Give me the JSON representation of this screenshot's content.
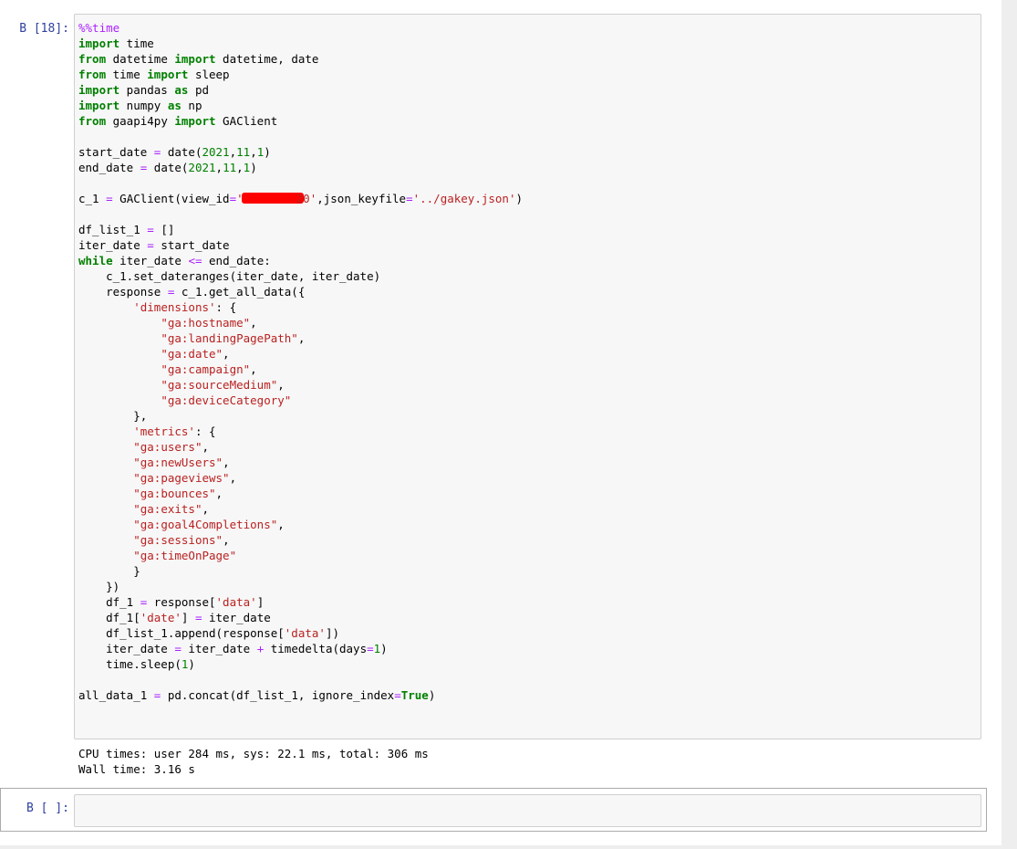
{
  "cells": [
    {
      "prompt": "В [18]:",
      "code": {
        "l1_magic": "%%time",
        "l2_import": "import",
        "l2_rest": " time",
        "l3_from": "from",
        "l3_mid": " datetime ",
        "l3_import": "import",
        "l3_rest": " datetime, date",
        "l4_from": "from",
        "l4_mid": " time ",
        "l4_import": "import",
        "l4_rest": " sleep",
        "l5_import": "import",
        "l5_mid": " pandas ",
        "l5_as": "as",
        "l5_rest": " pd",
        "l6_import": "import",
        "l6_mid": " numpy ",
        "l6_as": "as",
        "l6_rest": " np",
        "l7_from": "from",
        "l7_mid": " gaapi4py ",
        "l7_import": "import",
        "l7_rest": " GAClient",
        "l9_a": "start_date ",
        "l9_eq": "=",
        "l9_b": " date(",
        "l9_n1": "2021",
        "l9_c1": ",",
        "l9_n2": "11",
        "l9_c2": ",",
        "l9_n3": "1",
        "l9_d": ")",
        "l10_a": "end_date ",
        "l10_eq": "=",
        "l10_b": " date(",
        "l10_n1": "2021",
        "l10_c1": ",",
        "l10_n2": "11",
        "l10_c2": ",",
        "l10_n3": "1",
        "l10_d": ")",
        "l12_a": "c_1 ",
        "l12_eq": "=",
        "l12_b": " GAClient(view_id",
        "l12_eq2": "=",
        "l12_s1": "'",
        "l12_s1b": "20'",
        "l12_c": ",json_keyfile",
        "l12_eq3": "=",
        "l12_s2": "'../gakey.json'",
        "l12_d": ")",
        "l14_a": "df_list_1 ",
        "l14_eq": "=",
        "l14_b": " []",
        "l15_a": "iter_date ",
        "l15_eq": "=",
        "l15_b": " start_date",
        "l16_while": "while",
        "l16_a": " iter_date ",
        "l16_op": "<=",
        "l16_b": " end_date:",
        "l17": "    c_1.set_dateranges(iter_date, iter_date)",
        "l18_a": "    response ",
        "l18_eq": "=",
        "l18_b": " c_1.get_all_data({",
        "l19_ind": "        ",
        "l19_s": "'dimensions'",
        "l19_b": ": {",
        "l20_ind": "            ",
        "l20_s": "\"ga:hostname\"",
        "l20_b": ",",
        "l21_ind": "            ",
        "l21_s": "\"ga:landingPagePath\"",
        "l21_b": ",",
        "l22_ind": "            ",
        "l22_s": "\"ga:date\"",
        "l22_b": ",",
        "l23_ind": "            ",
        "l23_s": "\"ga:campaign\"",
        "l23_b": ",",
        "l24_ind": "            ",
        "l24_s": "\"ga:sourceMedium\"",
        "l24_b": ",",
        "l25_ind": "            ",
        "l25_s": "\"ga:deviceCategory\"",
        "l26": "        },",
        "l27_ind": "        ",
        "l27_s": "'metrics'",
        "l27_b": ": {",
        "l28_ind": "        ",
        "l28_s": "\"ga:users\"",
        "l28_b": ",",
        "l29_ind": "        ",
        "l29_s": "\"ga:newUsers\"",
        "l29_b": ",",
        "l30_ind": "        ",
        "l30_s": "\"ga:pageviews\"",
        "l30_b": ",",
        "l31_ind": "        ",
        "l31_s": "\"ga:bounces\"",
        "l31_b": ",",
        "l32_ind": "        ",
        "l32_s": "\"ga:exits\"",
        "l32_b": ",",
        "l33_ind": "        ",
        "l33_s": "\"ga:goal4Completions\"",
        "l33_b": ",",
        "l34_ind": "        ",
        "l34_s": "\"ga:sessions\"",
        "l34_b": ",",
        "l35_ind": "        ",
        "l35_s": "\"ga:timeOnPage\"",
        "l36": "        }",
        "l37": "    })",
        "l38_a": "    df_1 ",
        "l38_eq": "=",
        "l38_b": " response[",
        "l38_s": "'data'",
        "l38_c": "]",
        "l39_a": "    df_1[",
        "l39_s": "'date'",
        "l39_b": "] ",
        "l39_eq": "=",
        "l39_c": " iter_date",
        "l40_a": "    df_list_1.append(response[",
        "l40_s": "'data'",
        "l40_b": "])",
        "l41_a": "    iter_date ",
        "l41_eq": "=",
        "l41_b": " iter_date ",
        "l41_plus": "+",
        "l41_c": " timedelta(days",
        "l41_eq2": "=",
        "l41_n": "1",
        "l41_d": ")",
        "l42_a": "    time.sleep(",
        "l42_n": "1",
        "l42_b": ")",
        "l44_a": "all_data_1 ",
        "l44_eq": "=",
        "l44_b": " pd.concat(df_list_1, ignore_index",
        "l44_eq2": "=",
        "l44_true": "True",
        "l44_c": ")"
      },
      "output": {
        "line1": "CPU times: user 284 ms, sys: 22.1 ms, total: 306 ms",
        "line2": "Wall time: 3.16 s"
      }
    },
    {
      "prompt": "В [ ]:",
      "code_value": ""
    }
  ]
}
